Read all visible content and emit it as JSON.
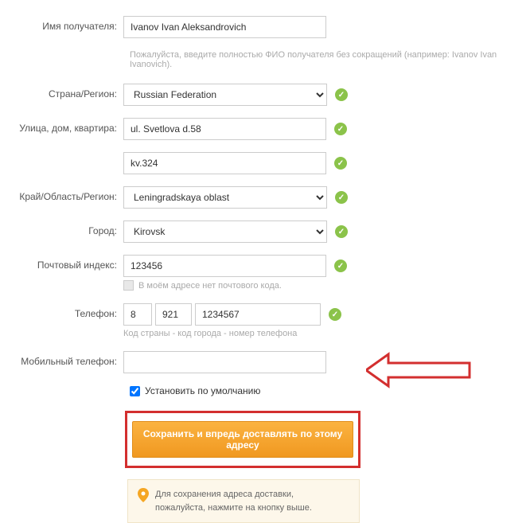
{
  "labels": {
    "name": "Имя получателя:",
    "country": "Страна/Регион:",
    "street": "Улица, дом, квартира:",
    "region": "Край/Область/Регион:",
    "city": "Город:",
    "postal": "Почтовый индекс:",
    "phone": "Телефон:",
    "mobile": "Мобильный телефон:"
  },
  "values": {
    "name": "Ivanov Ivan Aleksandrovich",
    "country": "Russian Federation",
    "street1": "ul. Svetlova d.58",
    "street2": "kv.324",
    "region": "Leningradskaya oblast",
    "city": "Kirovsk",
    "postal": "123456",
    "phone_cc": "8",
    "phone_area": "921",
    "phone_num": "1234567",
    "mobile": ""
  },
  "hints": {
    "name": "Пожалуйста, введите полностью ФИО получателя без сокращений (например: Ivanov Ivan Ivanovich).",
    "postal_nocode": "В моём адресе нет почтового кода.",
    "phone": "Код страны - код города - номер телефона"
  },
  "checkbox": {
    "default": "Установить по умолчанию"
  },
  "button": {
    "submit": "Сохранить и впредь доставлять по этому адресу"
  },
  "info": {
    "line1": "Для сохранения адреса доставки,",
    "line2": "пожалуйста, нажмите на кнопку выше."
  }
}
